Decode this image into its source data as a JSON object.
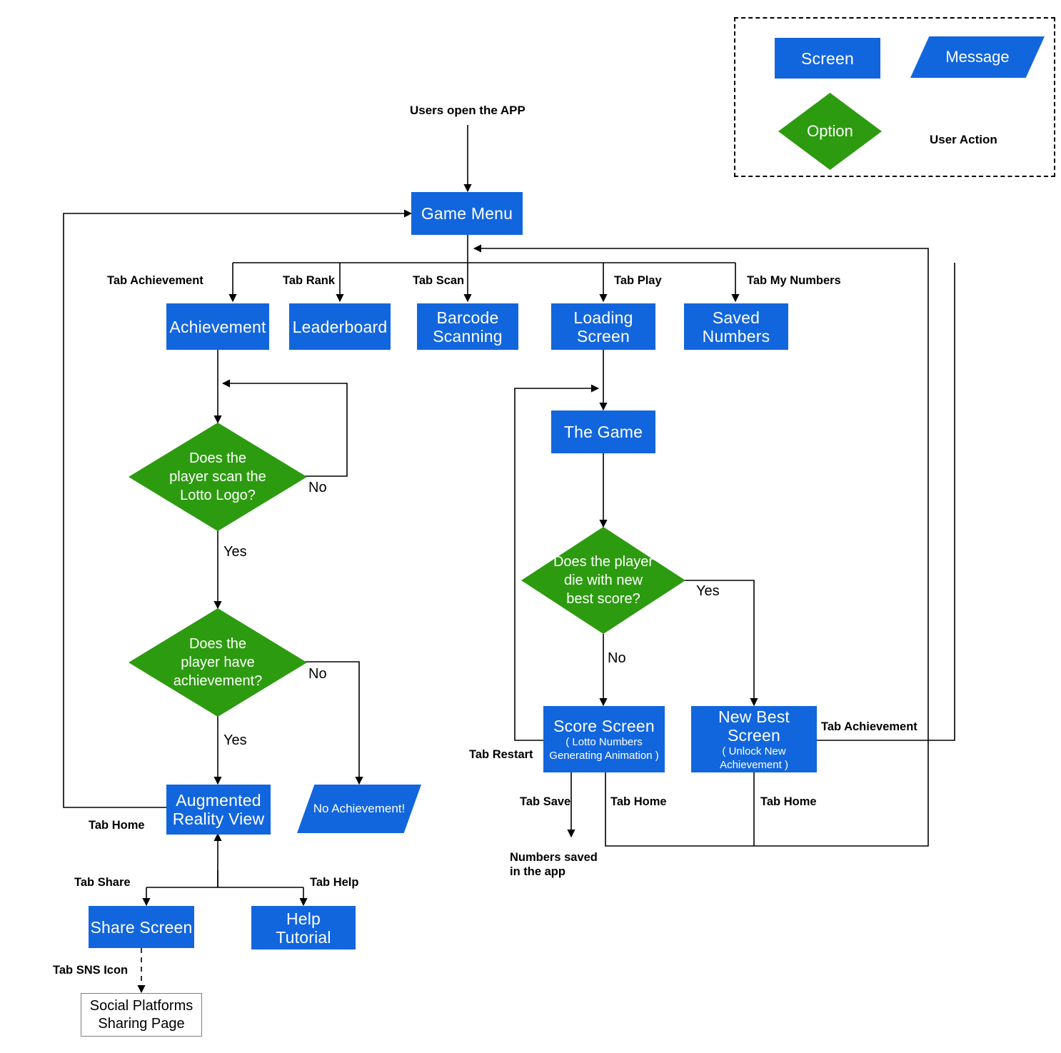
{
  "diagram": {
    "type": "flowchart",
    "title_note": "Users open the APP",
    "colors": {
      "screen": "#1266dd",
      "option": "#2d9b10",
      "message": "#1266dd",
      "line": "#000000",
      "text_on_shape": "#ffffff"
    }
  },
  "legend": {
    "screen": "Screen",
    "message": "Message",
    "option": "Option",
    "user_action": "User Action"
  },
  "nodes": {
    "entry": "Users open the APP",
    "game_menu": "Game Menu",
    "achievement": "Achievement",
    "leaderboard": "Leaderboard",
    "barcode_scanning": "Barcode\nScanning",
    "loading_screen": "Loading\nScreen",
    "saved_numbers": "Saved\nNumbers",
    "the_game": "The Game",
    "q_scan_logo": "Does the\nplayer scan the\nLotto Logo?",
    "q_have_achievement": "Does the\nplayer have\nachievement?",
    "q_new_best": "Does the player\ndie with new\nbest score?",
    "ar_view": "Augmented\nReality View",
    "no_achievement_msg": "No Achievement!",
    "score_screen_title": "Score Screen",
    "score_screen_sub": "( Lotto Numbers\nGenerating Animation )",
    "new_best_title": "New Best Screen",
    "new_best_sub": "( Unlock New\nAchievement )",
    "share_screen": "Share Screen",
    "help_tutorial": "Help\nTutorial",
    "social_platforms": "Social Platforms\nSharing Page",
    "numbers_saved": "Numbers saved\nin the app"
  },
  "edge_labels": {
    "tab_achievement": "Tab Achievement",
    "tab_rank": "Tab Rank",
    "tab_scan": "Tab Scan",
    "tab_play": "Tab Play",
    "tab_my_numbers": "Tab My Numbers",
    "tab_home_left": "Tab Home",
    "tab_share": "Tab Share",
    "tab_help": "Tab Help",
    "tab_sns_icon": "Tab SNS Icon",
    "tab_restart": "Tab Restart",
    "tab_save": "Tab Save",
    "tab_home_score": "Tab Home",
    "tab_home_newbest": "Tab Home",
    "tab_achievement_newbest": "Tab Achievement",
    "yes_scan": "Yes",
    "no_scan": "No",
    "yes_have": "Yes",
    "no_have": "No",
    "yes_best": "Yes",
    "no_best": "No"
  }
}
